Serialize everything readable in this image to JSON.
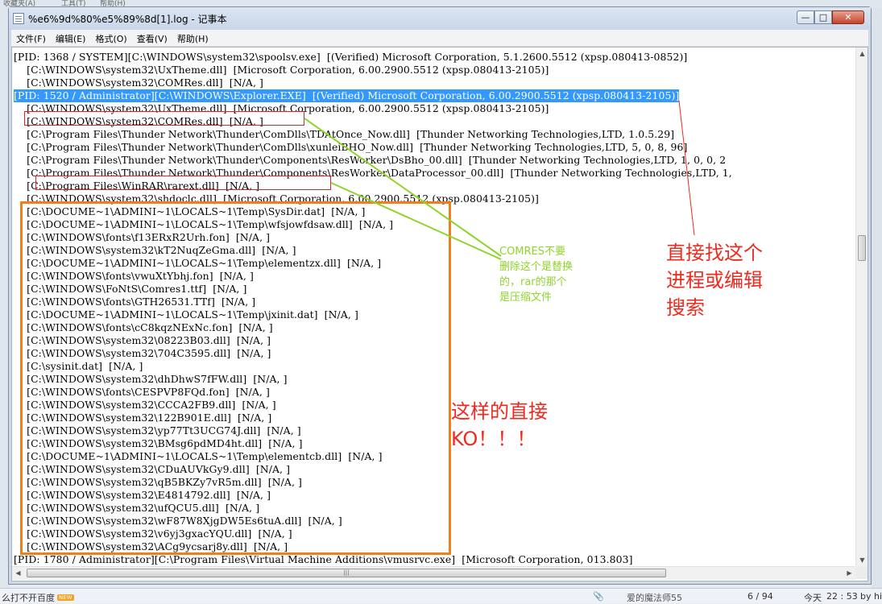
{
  "window": {
    "title": "%e6%9d%80%e5%89%8d[1].log - 记事本",
    "buttons": {
      "minimize": "—",
      "maximize": "□",
      "close": "✕"
    }
  },
  "menu": [
    "文件(F)",
    "编辑(E)",
    "格式(O)",
    "查看(V)",
    "帮助(H)"
  ],
  "lines": [
    "[PID: 1368 / SYSTEM][C:\\WINDOWS\\system32\\spoolsv.exe]  [(Verified) Microsoft Corporation, 5.1.2600.5512 (xpsp.080413-0852)]",
    "    [C:\\WINDOWS\\system32\\UxTheme.dll]  [Microsoft Corporation, 6.00.2900.5512 (xpsp.080413-2105)]",
    "    [C:\\WINDOWS\\system32\\COMRes.dll]  [N/A, ]",
    "[PID: 1520 / Administrator][C:\\WINDOWS\\Explorer.EXE]  [(Verified) Microsoft Corporation, 6.00.2900.5512 (xpsp.080413-2105)]",
    "    [C:\\WINDOWS\\system32\\UxTheme.dll]  [Microsoft Corporation, 6.00.2900.5512 (xpsp.080413-2105)]",
    "    [C:\\WINDOWS\\system32\\COMRes.dll]  [N/A, ]",
    "    [C:\\Program Files\\Thunder Network\\Thunder\\ComDlls\\TDAtOnce_Now.dll]  [Thunder Networking Technologies,LTD, 1.0.5.29]",
    "    [C:\\Program Files\\Thunder Network\\Thunder\\ComDlls\\xunleiBHO_Now.dll]  [Thunder Networking Technologies,LTD, 5, 0, 8, 96]",
    "    [C:\\Program Files\\Thunder Network\\Thunder\\Components\\ResWorker\\DsBho_00.dll]  [Thunder Networking Technologies,LTD, 1, 0, 0, 2",
    "    [C:\\Program Files\\Thunder Network\\Thunder\\Components\\ResWorker\\DataProcessor_00.dll]  [Thunder Networking Technologies,LTD, 1,",
    "    [C:\\Program Files\\WinRAR\\rarext.dll]  [N/A, ]",
    "    [C:\\WINDOWS\\system32\\shdoclc.dll]  [Microsoft Corporation, 6.00.2900.5512 (xpsp.080413-2105)]",
    "    [C:\\DOCUME~1\\ADMINI~1\\LOCALS~1\\Temp\\SysDir.dat]  [N/A, ]",
    "    [C:\\DOCUME~1\\ADMINI~1\\LOCALS~1\\Temp\\wfsjowfdsaw.dll]  [N/A, ]",
    "    [C:\\WINDOWS\\fonts\\f13ERxR2Urh.fon]  [N/A, ]",
    "    [C:\\WINDOWS\\system32\\kT2NuqZeGma.dll]  [N/A, ]",
    "    [C:\\DOCUME~1\\ADMINI~1\\LOCALS~1\\Temp\\elementzx.dll]  [N/A, ]",
    "    [C:\\WINDOWS\\fonts\\vwuXtYbhj.fon]  [N/A, ]",
    "    [C:\\WINDOWS\\FoNtS\\Comres1.ttf]  [N/A, ]",
    "    [C:\\WINDOWS\\fonts\\GTH26531.TTf]  [N/A, ]",
    "    [C:\\DOCUME~1\\ADMINI~1\\LOCALS~1\\Temp\\jxinit.dat]  [N/A, ]",
    "    [C:\\WINDOWS\\fonts\\cC8kqzNExNc.fon]  [N/A, ]",
    "    [C:\\WINDOWS\\system32\\08223B03.dll]  [N/A, ]",
    "    [C:\\WINDOWS\\system32\\704C3595.dll]  [N/A, ]",
    "    [C:\\sysinit.dat]  [N/A, ]",
    "    [C:\\WINDOWS\\system32\\dhDhwS7fFW.dll]  [N/A, ]",
    "    [C:\\WINDOWS\\fonts\\CESPVP8FQd.fon]  [N/A, ]",
    "    [C:\\WINDOWS\\system32\\CCCA2FB9.dll]  [N/A, ]",
    "    [C:\\WINDOWS\\system32\\122B901E.dll]  [N/A, ]",
    "    [C:\\WINDOWS\\system32\\yp77Tt3UCG74J.dll]  [N/A, ]",
    "    [C:\\WINDOWS\\system32\\BMsg6pdMD4ht.dll]  [N/A, ]",
    "    [C:\\DOCUME~1\\ADMINI~1\\LOCALS~1\\Temp\\elementcb.dll]  [N/A, ]",
    "    [C:\\WINDOWS\\system32\\CDuAUVkGy9.dll]  [N/A, ]",
    "    [C:\\WINDOWS\\system32\\qB5BKZy7vR5m.dll]  [N/A, ]",
    "    [C:\\WINDOWS\\system32\\E4814792.dll]  [N/A, ]",
    "    [C:\\WINDOWS\\system32\\ufQCU5.dll]  [N/A, ]",
    "    [C:\\WINDOWS\\system32\\wF87W8XjgDW5Es6tuA.dll]  [N/A, ]",
    "    [C:\\WINDOWS\\system32\\v6yj3gxacYQU.dll]  [N/A, ]",
    "    [C:\\WINDOWS\\system32\\ACg9ycsarj8y.dll]  [N/A, ]",
    "[PID: 1780 / Administrator][C:\\Program Files\\Virtual Machine Additions\\vmusrvc.exe]  [Microsoft Corporation, 013.803]"
  ],
  "selected_line": 3,
  "annotations": {
    "green_note": "COMRES不要删除这个是替换的，rar的那个是压缩文件",
    "red_note": "直接找这个进程或编辑搜索",
    "ko_note": "这样的直接KO！！！",
    "colors": {
      "red": "#ee2a1f",
      "green": "#8fd42c",
      "orange": "#ef7f1a",
      "selection": "#3399ff"
    }
  },
  "taskbar": {
    "left_text": "么打不开百度",
    "left_badge": "NEW",
    "middle_text": "爱的魔法师55",
    "page_counter": "6 / 94",
    "date_label": "今天",
    "time": "22 : 53",
    "by_text": "by hi"
  },
  "background": {
    "top_left": "收藏夹(A)",
    "top_mid1": "工具(T)",
    "top_mid2": "帮助(H)"
  }
}
